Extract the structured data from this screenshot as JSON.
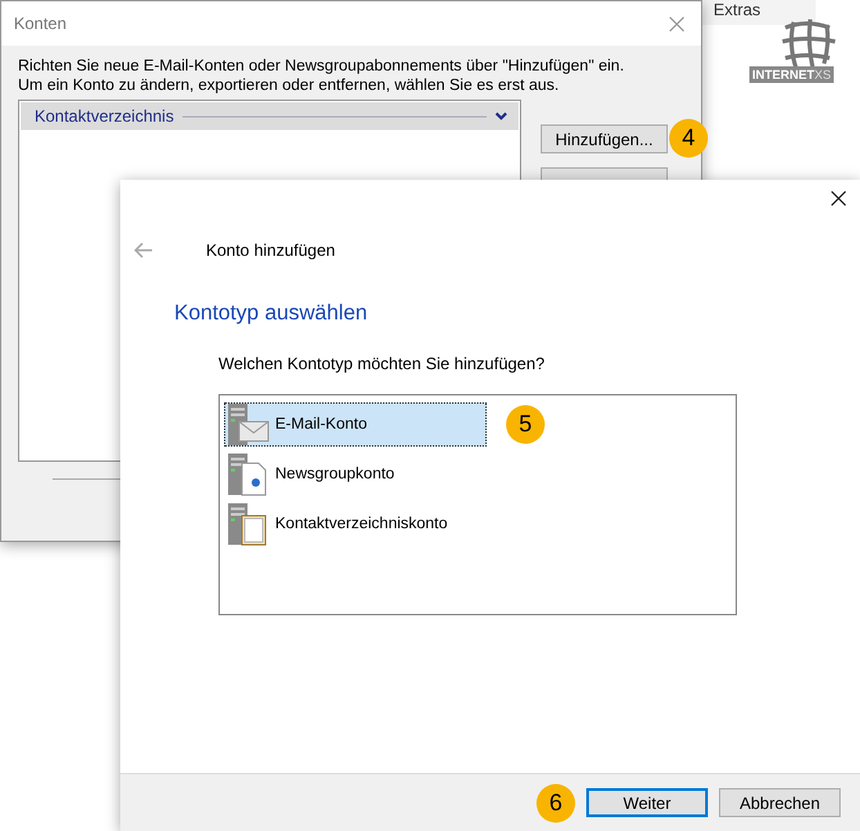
{
  "background_app": {
    "ribbon_tab": "Extras",
    "logo_text": "INTERNET",
    "logo_suffix": "XS"
  },
  "accounts_window": {
    "title": "Konten",
    "instructions": [
      "Richten Sie neue E-Mail-Konten oder Newsgroupabonnements über \"Hinzufügen\" ein.",
      "Um ein Konto zu ändern, exportieren oder entfernen, wählen Sie es erst aus."
    ],
    "group_header": "Kontaktverzeichnis",
    "buttons": [
      {
        "label": "Hinzufügen...",
        "badge": "4"
      },
      {
        "covered": true
      }
    ]
  },
  "add_account_dialog": {
    "title": "Konto hinzufügen",
    "heading": "Kontotyp auswählen",
    "question": "Welchen Kontotyp möchten Sie hinzufügen?",
    "account_types": [
      {
        "label": "E-Mail-Konto",
        "kind": "mail",
        "selected": true,
        "badge": "5"
      },
      {
        "label": "Newsgroupkonto",
        "kind": "news",
        "selected": false
      },
      {
        "label": "Kontaktverzeichniskonto",
        "kind": "directory",
        "selected": false
      }
    ],
    "footer_badge": "6",
    "buttons": [
      {
        "label": "Weiter",
        "default": true
      },
      {
        "label": "Abbrechen",
        "default": false
      }
    ]
  }
}
